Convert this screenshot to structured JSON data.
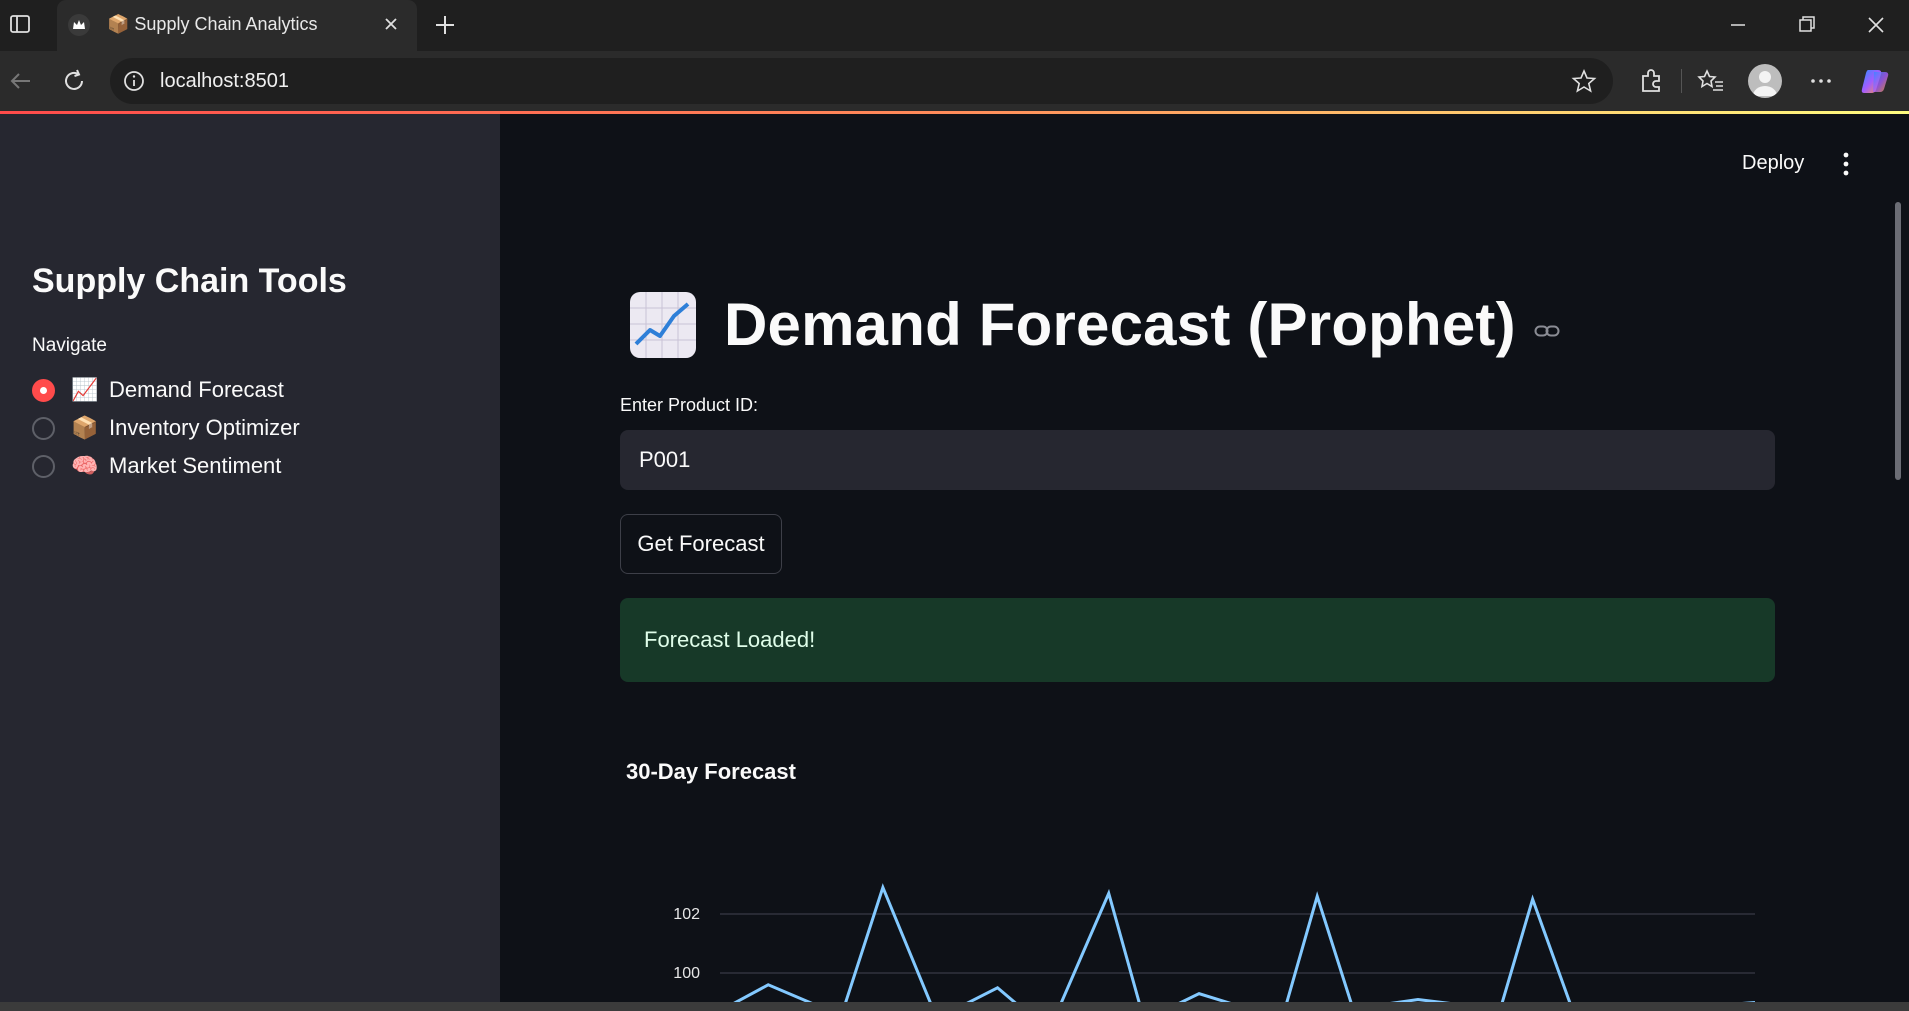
{
  "browser": {
    "tab_title": "📦 Supply Chain Analytics",
    "url": "localhost:8501"
  },
  "app": {
    "deploy_label": "Deploy"
  },
  "sidebar": {
    "title": "Supply Chain Tools",
    "nav_label": "Navigate",
    "options": [
      {
        "emoji": "📈",
        "label": "Demand Forecast",
        "selected": true
      },
      {
        "emoji": "📦",
        "label": "Inventory Optimizer",
        "selected": false
      },
      {
        "emoji": "🧠",
        "label": "Market Sentiment",
        "selected": false
      }
    ]
  },
  "main": {
    "title": "Demand Forecast (Prophet)",
    "title_icon": "chart-increasing-icon",
    "input_label": "Enter Product ID:",
    "input_value": "P001",
    "button_label": "Get Forecast",
    "success_message": "Forecast Loaded!",
    "chart_title": "30-Day Forecast"
  },
  "chart_data": {
    "type": "line",
    "title": "30-Day Forecast",
    "ylabel": "",
    "xlabel": "",
    "y_ticks": [
      100,
      102
    ],
    "ylim": [
      98.9,
      103.5
    ],
    "series": [
      {
        "color": "#83c9ff",
        "x": [
          0,
          1.1,
          2.5,
          3.3,
          4.4,
          5.8,
          6.7,
          7.7,
          8.3,
          9.5,
          10.9,
          11.8,
          12.8,
          13.5,
          14.6,
          16.0,
          16.9,
          17.9,
          18.6,
          19.8,
          21.2,
          22.2,
          23.1,
          24.2,
          25.3,
          26.5,
          27.4,
          28.4,
          29.5
        ],
        "y": [
          98.9,
          99.6,
          98.9,
          98.9,
          102.9,
          98.9,
          98.9,
          99.5,
          98.9,
          98.9,
          102.7,
          98.9,
          98.9,
          99.3,
          98.9,
          98.9,
          102.6,
          98.9,
          98.9,
          99.1,
          98.9,
          98.9,
          102.5,
          98.9,
          98.9,
          98.9,
          98.9,
          98.9,
          99.0
        ]
      }
    ]
  }
}
